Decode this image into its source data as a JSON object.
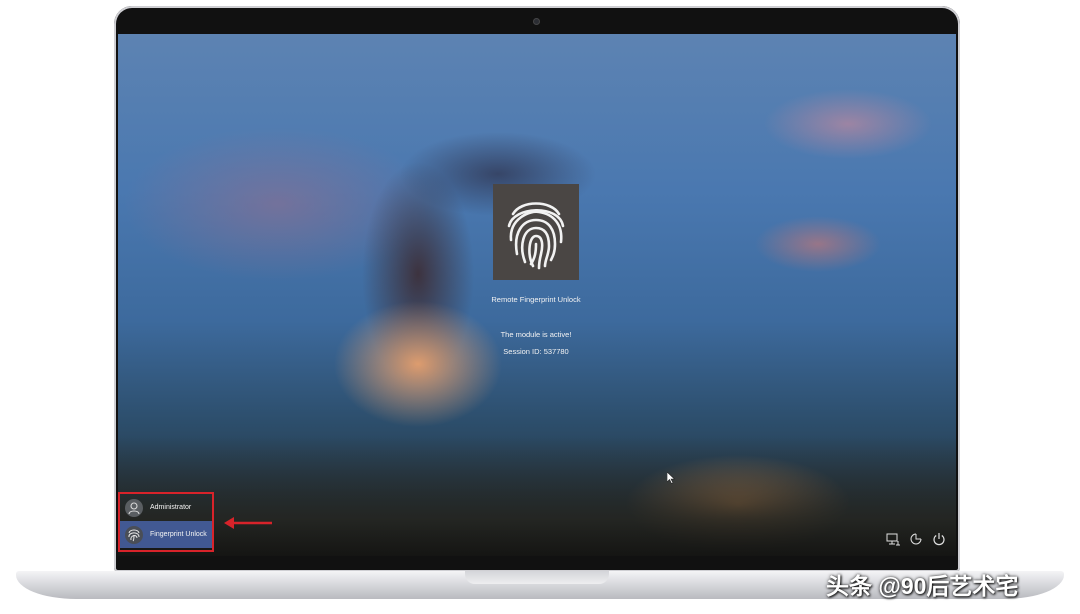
{
  "lock_screen": {
    "credential_title": "Remote Fingerprint Unlock",
    "status_message": "The module is active!",
    "session_line": "Session ID: 537780"
  },
  "user_list": [
    {
      "label": "Administrator",
      "icon": "user-icon",
      "selected": false
    },
    {
      "label": "Fingerprint Unlock",
      "icon": "fingerprint-icon",
      "selected": true
    }
  ],
  "tray_icons": [
    "network-icon",
    "accessibility-icon",
    "power-icon"
  ],
  "watermark": "头条 @90后艺术宅",
  "colors": {
    "highlight": "#d8232a",
    "selected_user_bg": "#465fa0"
  }
}
